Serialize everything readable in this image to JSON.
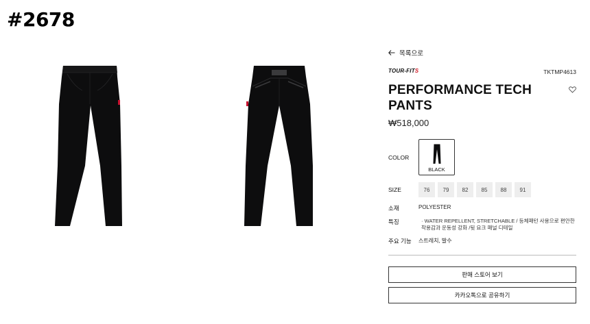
{
  "tag": "#2678",
  "gallery": {
    "images": [
      {
        "name": "front-view",
        "color": "#0d0d0e",
        "accent": "#c8102e"
      },
      {
        "name": "back-view",
        "color": "#0d0d0e",
        "accent": "#c8102e"
      }
    ]
  },
  "product": {
    "back_label": "목록으로",
    "brand": "TOUR-FIT",
    "brand_mark": "S",
    "sku": "TKTMP4613",
    "name_line1": "PERFORMANCE TECH",
    "name_line2": "PANTS",
    "price": "₩518,000",
    "color_label": "COLOR",
    "color_name": "BLACK",
    "size_label": "SIZE",
    "sizes": [
      "76",
      "79",
      "82",
      "85",
      "88",
      "91"
    ],
    "material_label": "소재",
    "material": "POLYESTER",
    "feature_label": "특징",
    "features": "· WATER REPELLENT, STRETCHABLE / 등체패턴 사용으로 편안한 착용감과 운동성 강화 /뒷 요크 패널 디테일",
    "key_label": "주요 기능",
    "key_functions": "스트레치, 발수"
  },
  "actions": {
    "store_button": "판매 스토어 보기",
    "share_button": "카카오톡으로 공유하기"
  },
  "colors": {
    "accent_red": "#d11e2a",
    "size_bg": "#eeeeee"
  }
}
